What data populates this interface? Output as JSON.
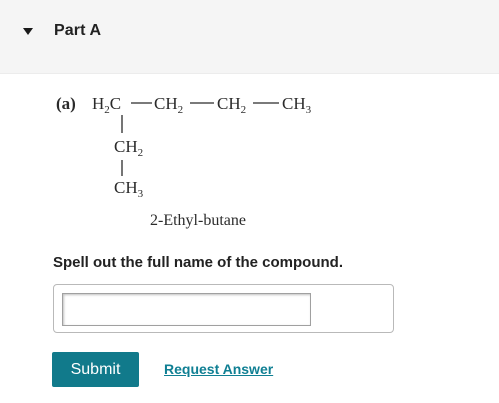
{
  "part": {
    "title": "Part A",
    "toggle_icon": "caret-down-icon"
  },
  "question": {
    "label": "(a)",
    "formula_main": {
      "h2c": [
        "H",
        "2",
        "C"
      ],
      "dash": "—",
      "ch2": [
        "CH",
        "2"
      ],
      "ch3": [
        "CH",
        "3"
      ]
    },
    "branch": {
      "ch2": [
        "CH",
        "2"
      ],
      "ch3": [
        "CH",
        "3"
      ]
    },
    "structure_caption": "2-Ethyl-butane",
    "prompt": "Spell out the full name of the compound."
  },
  "answer": {
    "value": "",
    "placeholder": ""
  },
  "actions": {
    "submit_label": "Submit",
    "request_label": "Request Answer"
  },
  "colors": {
    "submit_bg": "#117a8b",
    "link": "#0f7f93",
    "header_bg": "#f5f5f5"
  }
}
